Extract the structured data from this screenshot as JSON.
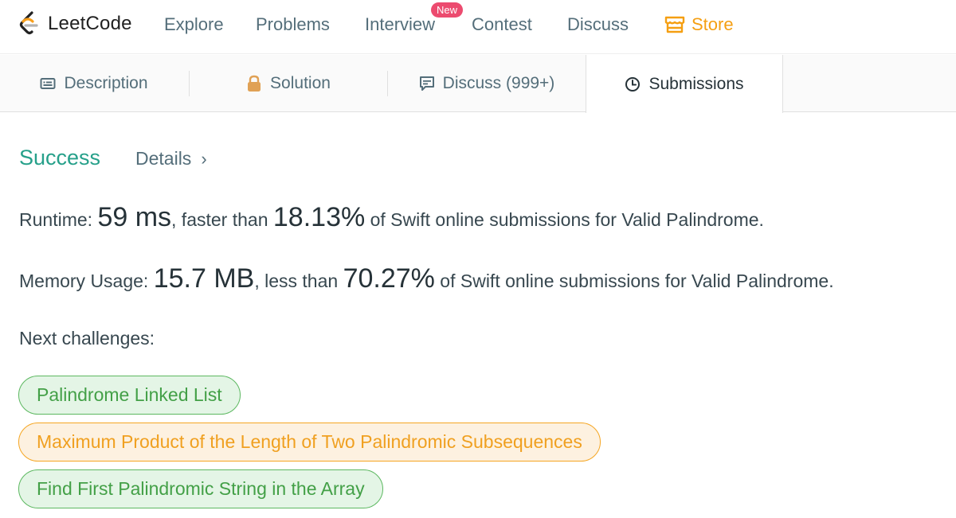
{
  "navbar": {
    "logo_text": "LeetCode",
    "items": [
      "Explore",
      "Problems",
      "Interview",
      "Contest",
      "Discuss"
    ],
    "new_badge": "New",
    "store_label": "Store",
    "store_color": "#f59f12"
  },
  "tabs": [
    {
      "label": "Description",
      "icon": "description-icon"
    },
    {
      "label": "Solution",
      "icon": "lock-icon"
    },
    {
      "label": "Discuss (999+)",
      "icon": "comment-icon"
    },
    {
      "label": "Submissions",
      "icon": "clock-icon",
      "active": true
    }
  ],
  "result": {
    "status": "Success",
    "status_color": "#26a08a",
    "details_label": "Details"
  },
  "runtime": {
    "label": "Runtime:",
    "value": "59 ms",
    "comparison": ", faster than",
    "percent": "18.13%",
    "suffix": "of Swift online submissions for Valid Palindrome."
  },
  "memory": {
    "label": "Memory Usage:",
    "value": "15.7 MB",
    "comparison": ", less than",
    "percent": "70.27%",
    "suffix": "of Swift online submissions for Valid Palindrome."
  },
  "next_challenges": {
    "title": "Next challenges:",
    "items": [
      {
        "label": "Palindrome Linked List",
        "difficulty": "easy"
      },
      {
        "label": "Maximum Product of the Length of Two Palindromic Subsequences",
        "difficulty": "medium"
      },
      {
        "label": "Find First Palindromic String in the Array",
        "difficulty": "easy"
      }
    ]
  }
}
